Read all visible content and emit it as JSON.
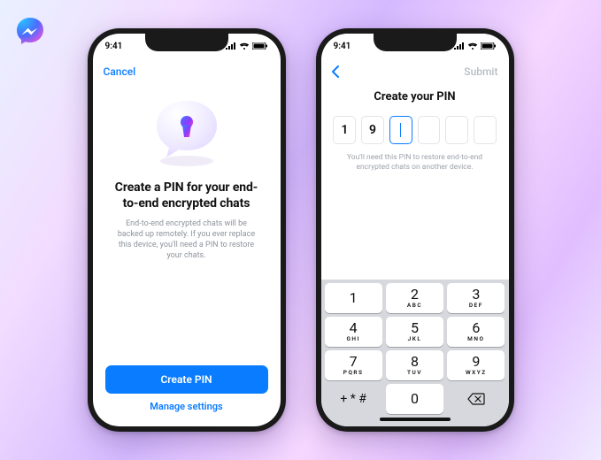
{
  "brand": {
    "name": "messenger-logo"
  },
  "status": {
    "time": "9:41",
    "signal_icon": "cellular-icon",
    "wifi_icon": "wifi-icon",
    "battery_icon": "battery-icon"
  },
  "colors": {
    "accent": "#0A7CFF",
    "muted": "#8E939C",
    "disabled": "#B8BCC4"
  },
  "left_phone": {
    "nav": {
      "cancel": "Cancel"
    },
    "illustration": "lock-speech-bubble-icon",
    "title": "Create a PIN for your end-to-end encrypted chats",
    "body": "End-to-end encrypted chats will be backed up remotely. If you ever replace this device, you'll need a PIN to restore your chats.",
    "cta": "Create PIN",
    "secondary": "Manage settings"
  },
  "right_phone": {
    "nav": {
      "back_icon": "chevron-left-icon",
      "submit": "Submit"
    },
    "title": "Create your PIN",
    "pin": {
      "digits": [
        "1",
        "9",
        "",
        "",
        "",
        ""
      ],
      "active_index": 2
    },
    "help": "You'll need this PIN to restore end-to-end encrypted chats on another device.",
    "keypad": {
      "rows": [
        [
          {
            "n": "1",
            "s": ""
          },
          {
            "n": "2",
            "s": "ABC"
          },
          {
            "n": "3",
            "s": "DEF"
          }
        ],
        [
          {
            "n": "4",
            "s": "GHI"
          },
          {
            "n": "5",
            "s": "JKL"
          },
          {
            "n": "6",
            "s": "MNO"
          }
        ],
        [
          {
            "n": "7",
            "s": "PQRS"
          },
          {
            "n": "8",
            "s": "TUV"
          },
          {
            "n": "9",
            "s": "WXYZ"
          }
        ]
      ],
      "bottom": {
        "left": "+ * #",
        "zero": "0",
        "delete_icon": "delete-icon"
      }
    }
  }
}
